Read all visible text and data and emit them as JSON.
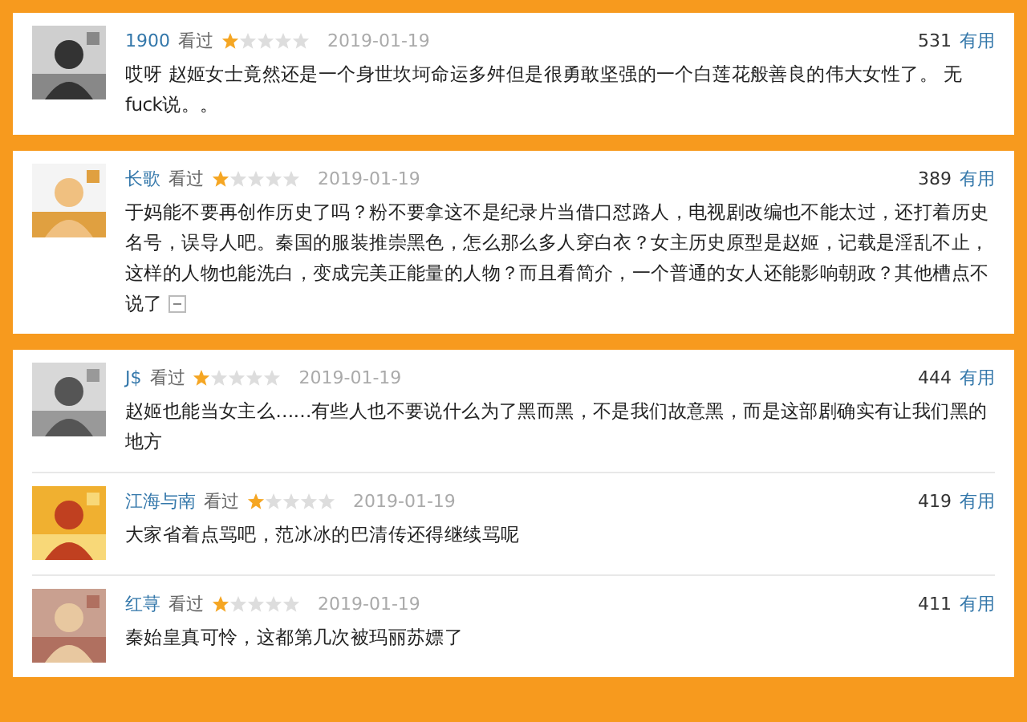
{
  "cards": [
    {
      "reviews": [
        {
          "user": "1900",
          "status": "看过",
          "stars": 1,
          "date": "2019-01-19",
          "votes": "531",
          "vote_label": "有用",
          "text": "哎呀 赵姬女士竟然还是一个身世坎坷命运多舛但是很勇敢坚强的一个白莲花般善良的伟大女性了。 无fuck说。。",
          "truncated": false
        }
      ]
    },
    {
      "reviews": [
        {
          "user": "长歌",
          "status": "看过",
          "stars": 1,
          "date": "2019-01-19",
          "votes": "389",
          "vote_label": "有用",
          "text": "于妈能不要再创作历史了吗？粉不要拿这不是纪录片当借口怼路人，电视剧改编也不能太过，还打着历史名号，误导人吧。秦国的服装推崇黑色，怎么那么多人穿白衣？女主历史原型是赵姬，记载是淫乱不止，这样的人物也能洗白，变成完美正能量的人物？而且看简介，一个普通的女人还能影响朝政？其他槽点不说了",
          "truncated": true
        }
      ]
    },
    {
      "reviews": [
        {
          "user": "J$",
          "status": "看过",
          "stars": 1,
          "date": "2019-01-19",
          "votes": "444",
          "vote_label": "有用",
          "text": "赵姬也能当女主么……有些人也不要说什么为了黑而黑，不是我们故意黑，而是这部剧确实有让我们黑的地方",
          "truncated": false
        },
        {
          "user": "江海与南",
          "status": "看过",
          "stars": 1,
          "date": "2019-01-19",
          "votes": "419",
          "vote_label": "有用",
          "text": "大家省着点骂吧，范冰冰的巴清传还得继续骂呢",
          "truncated": false
        },
        {
          "user": "红荨",
          "status": "看过",
          "stars": 1,
          "date": "2019-01-19",
          "votes": "411",
          "vote_label": "有用",
          "text": "秦始皇真可怜，这都第几次被玛丽苏嫖了",
          "truncated": false
        }
      ]
    }
  ]
}
